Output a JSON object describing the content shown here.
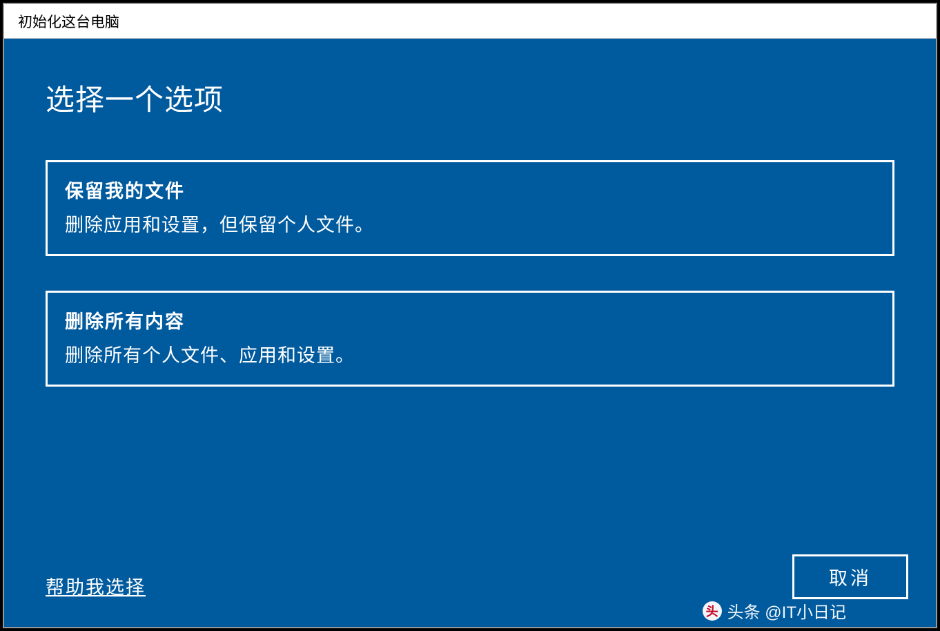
{
  "window": {
    "title": "初始化这台电脑"
  },
  "main": {
    "heading": "选择一个选项",
    "options": [
      {
        "title": "保留我的文件",
        "description": "删除应用和设置，但保留个人文件。"
      },
      {
        "title": "删除所有内容",
        "description": "删除所有个人文件、应用和设置。"
      }
    ],
    "help_link": "帮助我选择",
    "cancel_button": "取消"
  },
  "watermark": {
    "text": "头条 @IT小日记"
  }
}
